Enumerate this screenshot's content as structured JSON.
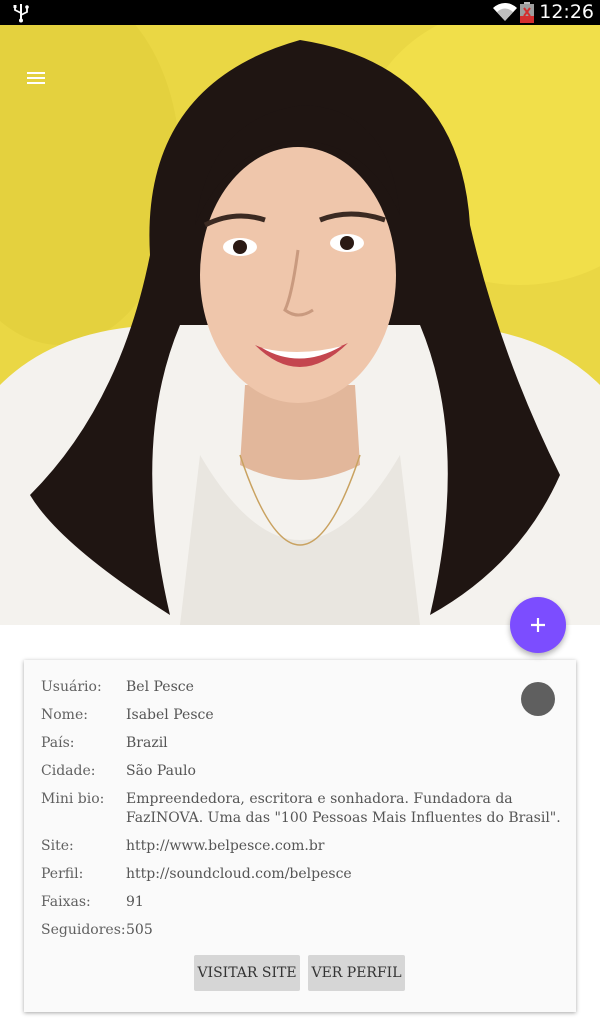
{
  "status_bar": {
    "time": "12:26",
    "icons": [
      "usb-icon",
      "wifi-icon",
      "battery-icon"
    ]
  },
  "toolbar": {
    "menu_icon": "hamburger-menu-icon"
  },
  "hero": {
    "image_description": "profile-photo",
    "background_color": "#ecd93f"
  },
  "fab": {
    "label": "+",
    "color": "#7c4dff"
  },
  "profile": {
    "fields": [
      {
        "label": "Usuário:",
        "value": "Bel Pesce"
      },
      {
        "label": "Nome:",
        "value": "Isabel Pesce"
      },
      {
        "label": "País:",
        "value": "Brazil"
      },
      {
        "label": "Cidade:",
        "value": "São Paulo"
      },
      {
        "label": "Mini bio:",
        "value": "Empreendedora, escritora e sonhadora. Fundadora da FazINOVA. Uma das \"100 Pessoas Mais Influentes do Brasil\"."
      },
      {
        "label": "Site:",
        "value": "http://www.belpesce.com.br"
      },
      {
        "label": "Perfil:",
        "value": "http://soundcloud.com/belpesce"
      },
      {
        "label": "Faixas:",
        "value": "91"
      },
      {
        "label": "Seguidores:",
        "value": "505"
      }
    ],
    "avatar_color": "#5f5f5f"
  },
  "actions": {
    "visit_site_label": "VISITAR SITE",
    "view_profile_label": "VER PERFIL"
  }
}
